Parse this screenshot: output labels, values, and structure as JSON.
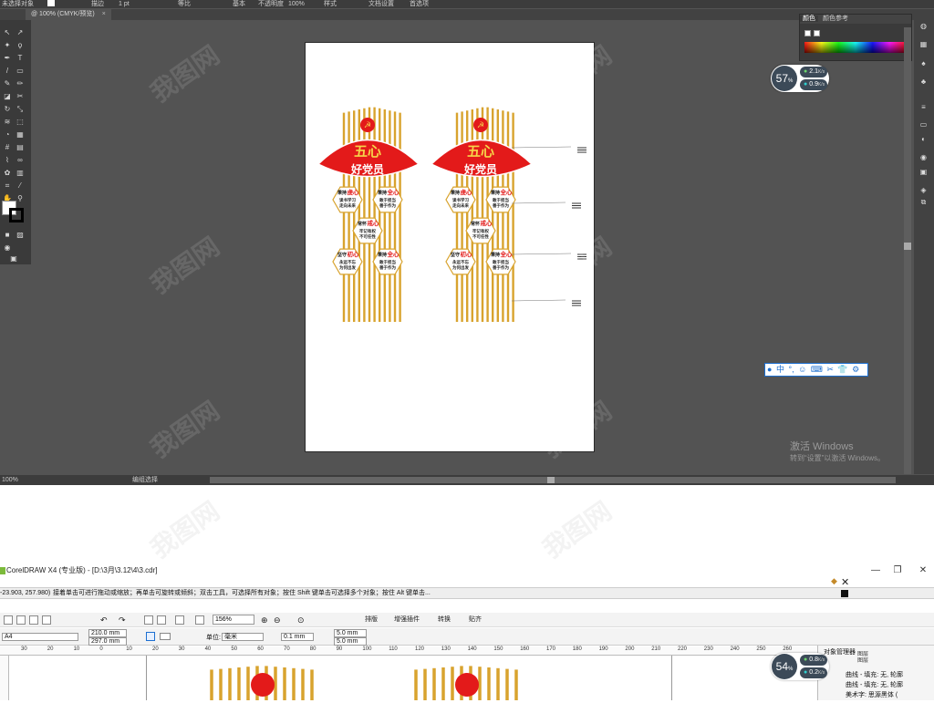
{
  "illustrator": {
    "control_bar": {
      "left_label": "未选择对象",
      "fill_label": "描边",
      "stroke_width": "1 pt",
      "stroke_style": "等比",
      "brush": "基本",
      "opacity_label": "不透明度",
      "opacity_value": "100%",
      "style_label": "样式",
      "doc_setup": "文档设置",
      "prefs": "首选项"
    },
    "doc_tab": {
      "label": "@ 100% (CMYK/预览)",
      "close": "×"
    },
    "status": {
      "zoom": "100%",
      "selection": "编组选择"
    },
    "color_panel": {
      "tab_color": "颜色",
      "tab_ref": "颜色参考"
    },
    "ime_bar": {
      "items": [
        "中",
        "°,",
        "☺",
        "⌨",
        "✂",
        "👕",
        "⚙"
      ]
    },
    "activate_windows": {
      "title": "激活 Windows",
      "subtitle": "转到“设置”以激活 Windows。"
    }
  },
  "speed_widgets": [
    {
      "percent": "57",
      "up": "2.1",
      "down": "0.9",
      "unit": "K/s"
    },
    {
      "percent": "54",
      "up": "0.8",
      "down": "0.2",
      "unit": "K/s"
    }
  ],
  "artwork": {
    "panels": [
      {
        "title_line1": "五心",
        "title_line2": "好党员",
        "hexagons": [
          {
            "prefix": "秉持",
            "key": "虔心",
            "line1": "读书学习",
            "line2": "走向未来"
          },
          {
            "prefix": "秉持",
            "key": "全心",
            "line1": "敢于担当",
            "line2": "善于作为"
          },
          {
            "prefix": "常怀",
            "key": "戒心",
            "line1": "牢记有权",
            "line2": "不可任性"
          },
          {
            "prefix": "坚守",
            "key": "初心",
            "line1": "永远不忘",
            "line2": "为何出发"
          },
          {
            "prefix": "秉持",
            "key": "全心",
            "line1": "敢于担当",
            "line2": "善于作为"
          }
        ]
      },
      {
        "title_line1": "五心",
        "title_line2": "好党员",
        "hexagons": [
          {
            "prefix": "秉持",
            "key": "虔心",
            "line1": "读书学习",
            "line2": "走向未来"
          },
          {
            "prefix": "秉持",
            "key": "全心",
            "line1": "敢于担当",
            "line2": "善于作为"
          },
          {
            "prefix": "常怀",
            "key": "戒心",
            "line1": "牢记有权",
            "line2": "不可任性"
          },
          {
            "prefix": "坚守",
            "key": "初心",
            "line1": "永远不忘",
            "line2": "为何出发"
          },
          {
            "prefix": "秉持",
            "key": "全心",
            "line1": "敢于担当",
            "line2": "善于作为"
          }
        ]
      }
    ]
  },
  "coreldraw": {
    "title": "CorelDRAW X4 (专业版) - [D:\\3月\\3.12\\4\\3.cdr]",
    "coords": "-23.903, 257.980)",
    "hint": "接着单击可进行拖动或缩放；再单击可旋转或倾斜；双击工具，可选择所有对象；按住 Shift 键单击可选择多个对象；按住 Alt 键单击...",
    "zoom": "156%",
    "toolbar1_labels": [
      "排版",
      "增强插件",
      "转换",
      "贴齐"
    ],
    "page_size": "A4",
    "width": "210.0 mm",
    "height": "297.0 mm",
    "units_label": "单位:",
    "units": "毫米",
    "nudge": "0.1 mm",
    "dup_x": "5.0 mm",
    "dup_y": "5.0 mm",
    "ruler_ticks": [
      "30",
      "20",
      "10",
      "0",
      "10",
      "20",
      "30",
      "40",
      "50",
      "60",
      "70",
      "80",
      "90",
      "100",
      "110",
      "120",
      "130",
      "140",
      "150",
      "160",
      "170",
      "180",
      "190",
      "200",
      "210",
      "220",
      "230",
      "240",
      "250",
      "260"
    ],
    "object_manager": {
      "title": "对象管理器",
      "items": [
        "曲线 - 填充: 无, 轮廓",
        "曲线 - 填充: 无, 轮廓",
        "美术字: 思源黑体 ("
      ]
    },
    "right_top_labels": [
      "图层",
      "图层"
    ]
  },
  "colors": {
    "red": "#e31a1a",
    "gold": "#d8a32e",
    "dark_ui": "#535353"
  }
}
